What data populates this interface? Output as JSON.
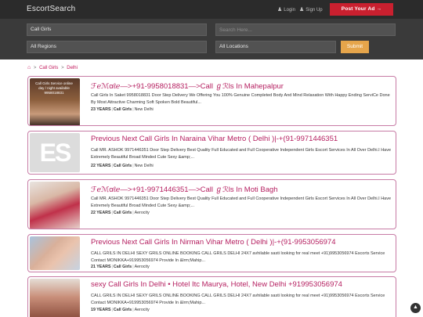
{
  "header": {
    "brand": "EscortSearch",
    "login_label": "Login",
    "signup_label": "Sign Up",
    "post_ad_label": "Post Your Ad →"
  },
  "search": {
    "category": "Call Girls",
    "keyword_placeholder": "Search Here...",
    "region": "All Regions",
    "location": "All Locations",
    "submit_label": "Submit"
  },
  "breadcrumb": {
    "items": [
      "Call Girls",
      "Delhi"
    ]
  },
  "listings": [
    {
      "title": "ℱℯℳαℓℯ—>+91-9958018831—>Call ℊℛls In Mahepalpur",
      "description": "Call Girls In Saket 9958018831 Door Step Delivery We Offering You 100% Genuine Completed Body And Mind Relaxation With Happy Ending ServiCe Done By Most Attractive Charming Soft Spoken Bold Beautiful...",
      "age": "23 YEARS",
      "category": "Call Girls",
      "location": "New Delhi",
      "thumb_text": "Call Girls Service online day / night available 9958018831"
    },
    {
      "title": "Previous Next Call Girls In Naraina Vihar Metro ( Delhi )|-+(91-9971446351",
      "description": "Call MR. ASHOK 9971446351 Door Step Delivery Best Quality Full Educated and Full Cooperative Independent Girls Escort Services In All Over Delhi.I Have Extremely Beautiful Broad Minded Cute Sexy &amp;...",
      "age": "22 YEARS",
      "category": "Call Girls",
      "location": "New Delhi",
      "thumb_text": "ES"
    },
    {
      "title": "ℱℯℳαℓℯ—>+91-9971446351—>Call ℊℛls In Moti Bagh",
      "description": "Call MR. ASHOK 9971446351 Door Step Delivery Best Quality Full Educated and Full Cooperative Independent Girls Escort Services In All Over Delhi.I Have Extremely Beautiful Broad Minded Cute Sexy &amp;...",
      "age": "22 YEARS",
      "category": "Call Girls",
      "location": "Aerocity",
      "thumb_text": ""
    },
    {
      "title": "Previous Next Call Girls In Nirman Vihar Metro ( Delhi )|-+(91-9953056974",
      "description": "CALL GRILS IN DELHI SEXY GRILS ONLINE BOOKING CALL GRILS DELHI 24X7 avhilable sasti looking for real meet +91)9953056974 Escorts Service Contact MONIKKA+919953056974 Provide In &lrm;Mahip...",
      "age": "21 YEARS",
      "category": "Call Girls",
      "location": "Aerocity",
      "thumb_text": ""
    },
    {
      "title": "sexy Call Girls In Delhi • Hotel Itc Maurya, Hotel, New Delhi +919953056974",
      "description": "CALL GRILS IN DELHI SEXY GRILS ONLINE BOOKING CALL GRILS DELHI 24X7 avhilable sasti looking for real meet +91)9953056974 Escorts Service Contact MONIKKA+919953056974 Provide In &lrm;Mahip...",
      "age": "19 YEARS",
      "category": "Call Girls",
      "location": "Aerocity",
      "thumb_text": ""
    }
  ],
  "colors": {
    "accent": "#b51f60",
    "post_button": "#c9202f",
    "submit_button": "#e6a54b",
    "card_border": "#c77ba5"
  }
}
